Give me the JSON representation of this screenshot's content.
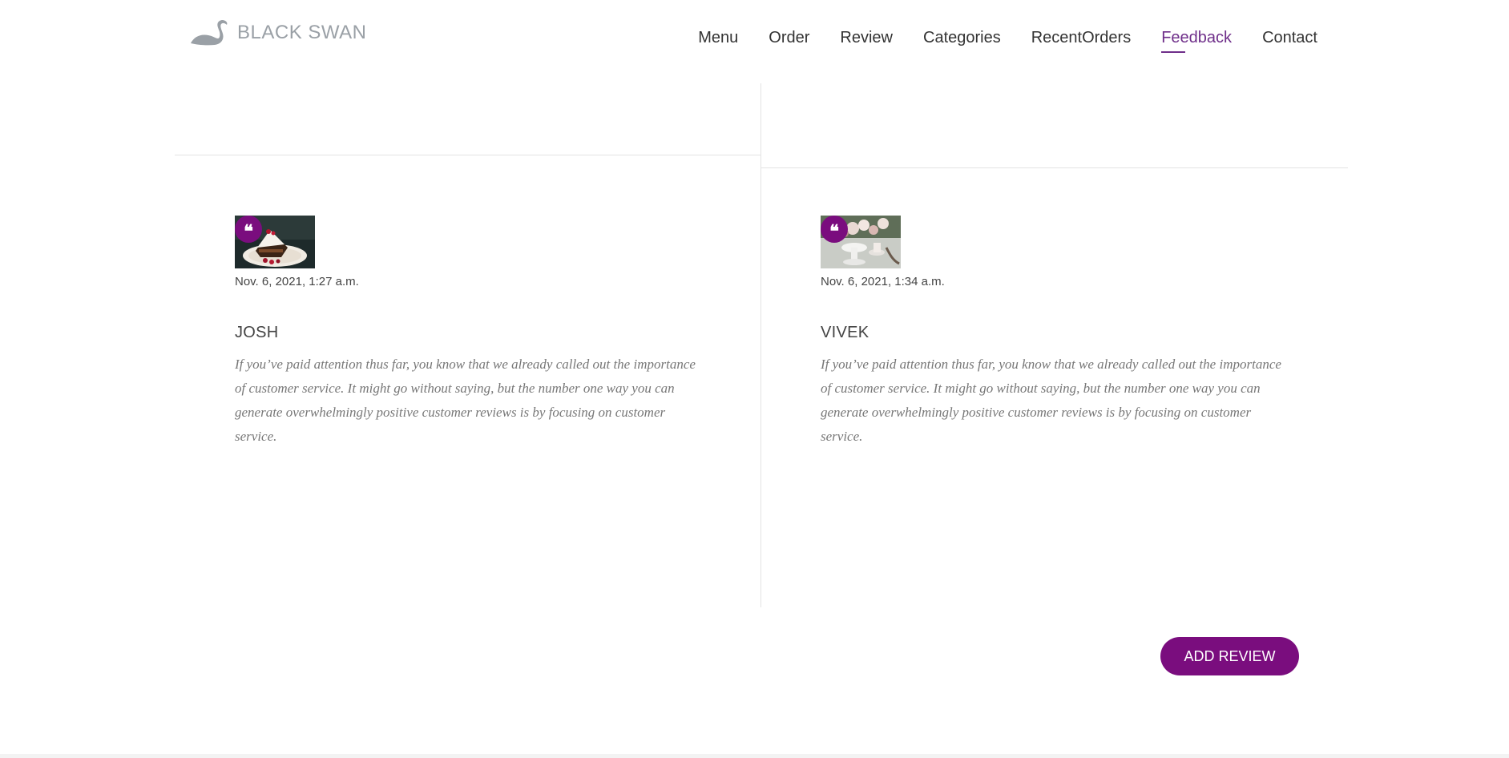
{
  "brand": {
    "name": "BLACK SWAN",
    "logo_icon": "swan-icon"
  },
  "nav": {
    "items": [
      {
        "label": "Menu",
        "active": false
      },
      {
        "label": "Order",
        "active": false
      },
      {
        "label": "Review",
        "active": false
      },
      {
        "label": "Categories",
        "active": false
      },
      {
        "label": "RecentOrders",
        "active": false
      },
      {
        "label": "Feedback",
        "active": true
      },
      {
        "label": "Contact",
        "active": false
      }
    ],
    "active_color": "#6f2f8a"
  },
  "reviews": [
    {
      "date": "Nov. 6, 2021, 1:27 a.m.",
      "name": "JOSH",
      "text": "If you’ve paid attention thus far, you know that we already called out the importance of customer service. It might go without saying, but the number one way you can generate overwhelmingly positive customer reviews is by focusing on customer service.",
      "image": "cake-slice-photo"
    },
    {
      "date": "Nov. 6, 2021, 1:34 a.m.",
      "name": "VIVEK",
      "text": "If you’ve paid attention thus far, you know that we already called out the importance of customer service. It might go without saying, but the number one way you can generate overwhelmingly positive customer reviews is by focusing on customer service.",
      "image": "flowers-cake-photo"
    }
  ],
  "actions": {
    "add_review_label": "ADD REVIEW"
  },
  "colors": {
    "accent": "#7a0d7e",
    "logo_gray": "#9aa0a6"
  }
}
